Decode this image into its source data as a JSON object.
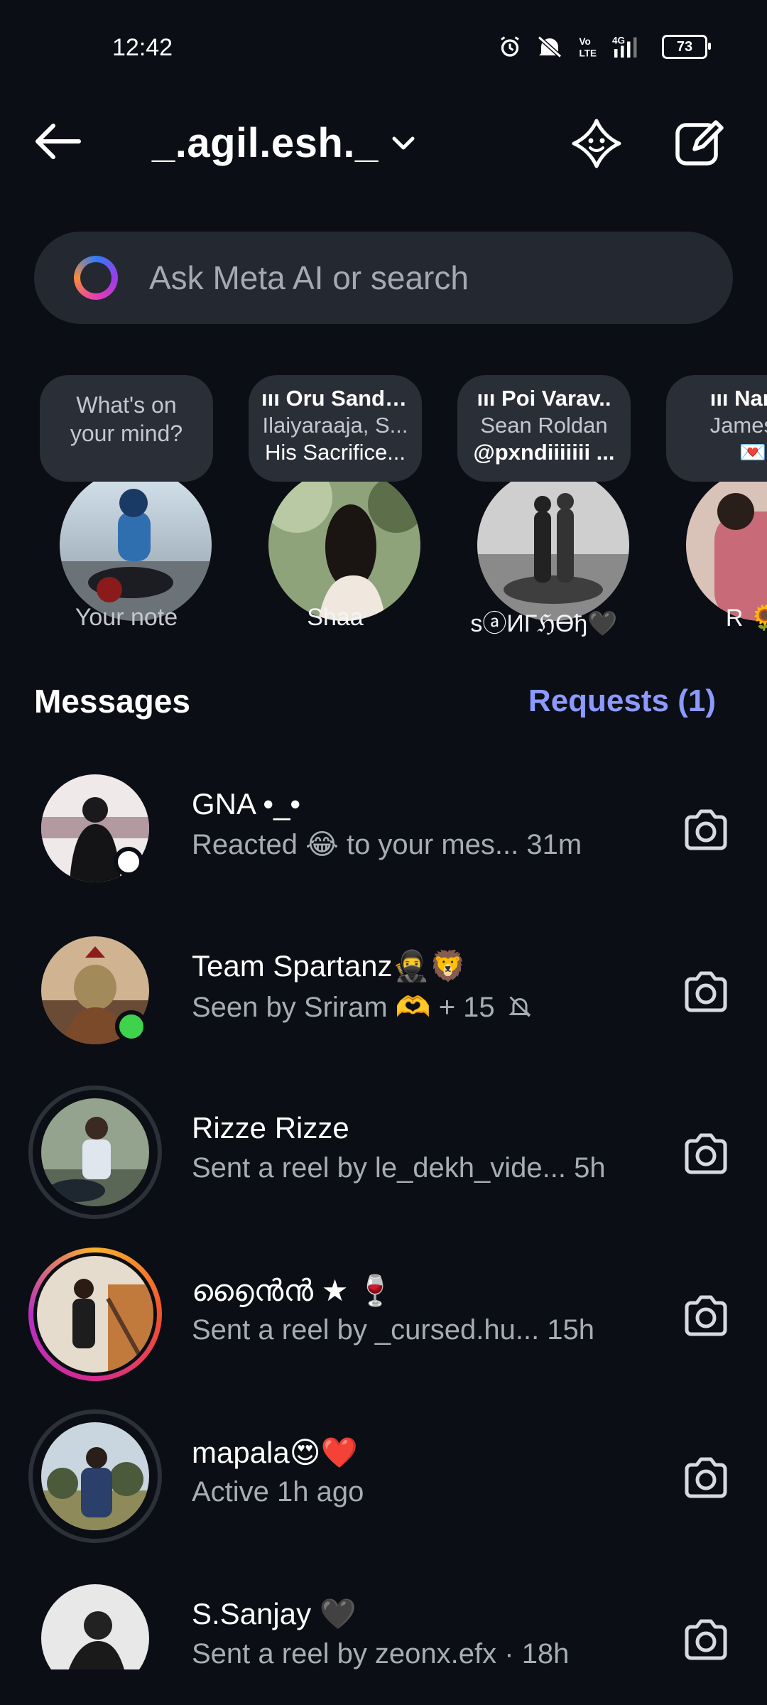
{
  "status_bar": {
    "time": "12:42",
    "battery": "73"
  },
  "header": {
    "account_name": "_.agil.esh._"
  },
  "search": {
    "placeholder": "Ask Meta AI or search"
  },
  "notes": [
    {
      "prompt_line1": "What's on",
      "prompt_line2": "your mind?",
      "label": "Your note"
    },
    {
      "title": "Oru Sandh..",
      "line2": "Ilaiyaraaja, S...",
      "line3": "His Sacrifice...",
      "label": "Shaa"
    },
    {
      "title": "Poi Varav..",
      "line2": "Sean Roldan",
      "line3": "@pxndiiiiiii ...",
      "label": "sⓐИГℌϴђ🖤"
    },
    {
      "title": "Nan p",
      "line2": "James V",
      "line3": "💌",
      "label": "R 🌻"
    }
  ],
  "section": {
    "title": "Messages",
    "requests": "Requests (1)"
  },
  "threads": [
    {
      "name": "GNA •_•",
      "preview": "Reacted 😂 to your mes...  31m"
    },
    {
      "name": "Team Spartanz🥷🦁",
      "preview": "Seen by Sriram 🫶 + 15"
    },
    {
      "name": "Rizze Rizze",
      "preview": "Sent a reel by le_dekh_vide...  5h"
    },
    {
      "name": "൭ൈൻൻ ★ 🍷",
      "preview": "Sent a reel by _cursed.hu...  15h"
    },
    {
      "name": "mapala😍❤️",
      "preview": "Active 1h ago"
    },
    {
      "name": "S.Sanjay 🖤",
      "preview": "Sent a reel by zeonx.efx · 18h"
    }
  ],
  "colors": {
    "background": "#0b0e14",
    "accent": "#8c9aff",
    "online": "#3ed34a"
  }
}
